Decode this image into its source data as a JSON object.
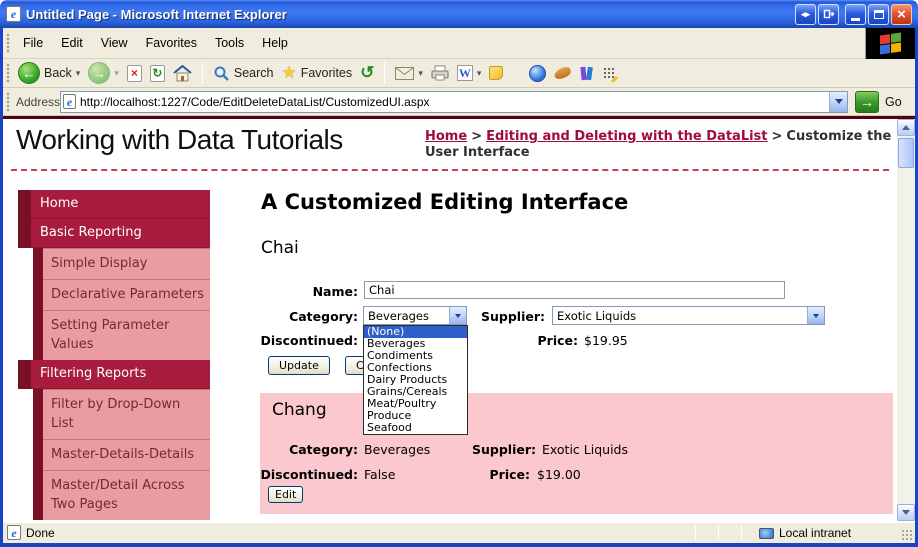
{
  "window": {
    "title": "Untitled Page - Microsoft Internet Explorer",
    "status_left": "Done",
    "status_right": "Local intranet"
  },
  "menu": {
    "items": [
      "File",
      "Edit",
      "View",
      "Favorites",
      "Tools",
      "Help"
    ]
  },
  "toolbar": {
    "back": "Back",
    "search": "Search",
    "favorites": "Favorites"
  },
  "address": {
    "label": "Address",
    "url": "http://localhost:1227/Code/EditDeleteDataList/CustomizedUI.aspx",
    "go": "Go"
  },
  "header": {
    "site_title": "Working with Data Tutorials",
    "crumb1": "Home",
    "sep": ">",
    "crumb2": "Editing and Deleting with the DataList",
    "crumb3": "Customize the User Interface"
  },
  "sidebar": {
    "items": [
      {
        "label": "Home",
        "level": 1
      },
      {
        "label": "Basic Reporting",
        "level": 1
      },
      {
        "label": "Simple Display",
        "level": 2
      },
      {
        "label": "Declarative Parameters",
        "level": 2
      },
      {
        "label": "Setting Parameter Values",
        "level": 2
      },
      {
        "label": "Filtering Reports",
        "level": 1
      },
      {
        "label": "Filter by Drop-Down List",
        "level": 2
      },
      {
        "label": "Master-Details-Details",
        "level": 2
      },
      {
        "label": "Master/Detail Across Two Pages",
        "level": 2
      }
    ]
  },
  "content": {
    "page_heading": "A Customized Editing Interface",
    "edit_item": {
      "product": "Chai",
      "name_label": "Name:",
      "name_value": "Chai",
      "category_label": "Category:",
      "category_value": "Beverages",
      "supplier_label": "Supplier:",
      "supplier_value": "Exotic Liquids",
      "discontinued_label": "Discontinued:",
      "price_label": "Price:",
      "price_value": "$19.95",
      "update_button": "Update",
      "cancel_button": "Cancel"
    },
    "category_dropdown": {
      "selected": "(None)",
      "options": [
        "(None)",
        "Beverages",
        "Condiments",
        "Confections",
        "Dairy Products",
        "Grains/Cereals",
        "Meat/Poultry",
        "Produce",
        "Seafood"
      ]
    },
    "view_item": {
      "product": "Chang",
      "category_label": "Category:",
      "category_value": "Beverages",
      "supplier_label": "Supplier:",
      "supplier_value": "Exotic Liquids",
      "discontinued_label": "Discontinued:",
      "discontinued_value": "False",
      "price_label": "Price:",
      "price_value": "$19.00",
      "edit_button": "Edit"
    }
  },
  "glyphs": {
    "ie_e": "e",
    "back_arrow": "←",
    "forward_arrow": "→",
    "stop_x": "×",
    "refresh_arrow": "↻",
    "history_arrow": "↺",
    "star": "★",
    "caret_down": "▾",
    "word_w": "W",
    "close_x": "×",
    "resize_pair": "◂▸",
    "go_arrow": "→"
  },
  "colors": {
    "accent_dark_red": "#7a1024",
    "accent_red": "#a81d3e",
    "accent_pink": "#e99da3",
    "link_red": "#a00d3a",
    "row_pink": "#fac8ce",
    "selection_blue": "#2e5fc8",
    "titlebar_blue": "#3d7bf2",
    "chrome_tan": "#ece9d8"
  }
}
